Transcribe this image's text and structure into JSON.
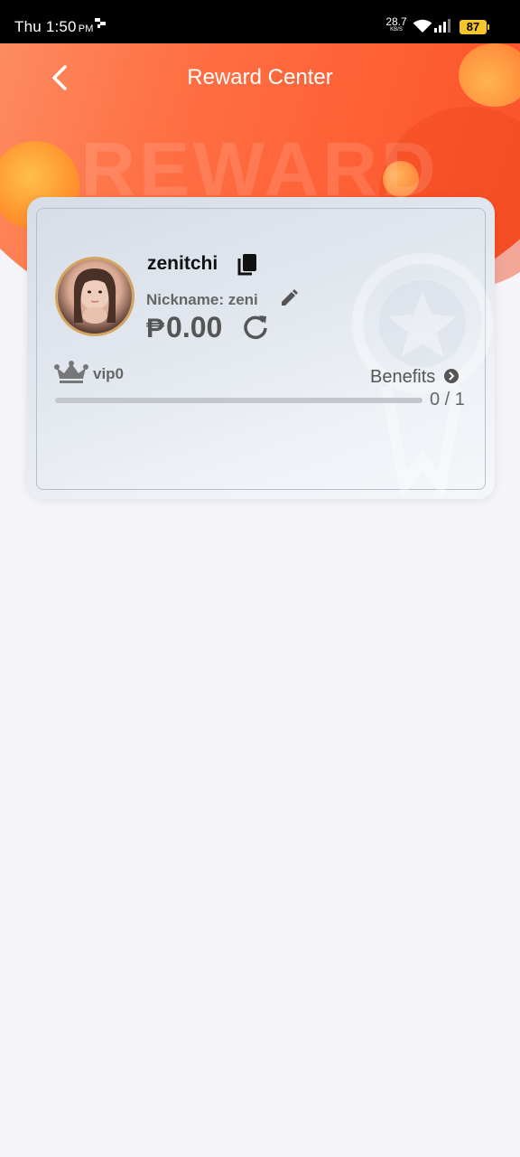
{
  "status_bar": {
    "time": "Thu 1:50",
    "ampm": "PM",
    "net_speed_value": "28.7",
    "net_speed_unit": "KB/S",
    "battery": "87"
  },
  "header": {
    "title": "Reward Center",
    "watermark": "REWARD"
  },
  "card": {
    "username": "zenitchi",
    "nickname": "Nickname: zeni",
    "currency_symbol": "₱",
    "balance": "0.00",
    "vip_level": "vip0",
    "benefits_label": "Benefits",
    "progress_text": "0 / 1",
    "progress_fraction": 0
  },
  "colors": {
    "accent": "#ff5e33",
    "avatar_ring": "#d4a461",
    "battery": "#f5c62a"
  },
  "icons": [
    "back-icon",
    "copy-icon",
    "edit-icon",
    "refresh-icon",
    "crown-icon",
    "chevron-right-icon",
    "wifi-icon",
    "signal-icon"
  ]
}
